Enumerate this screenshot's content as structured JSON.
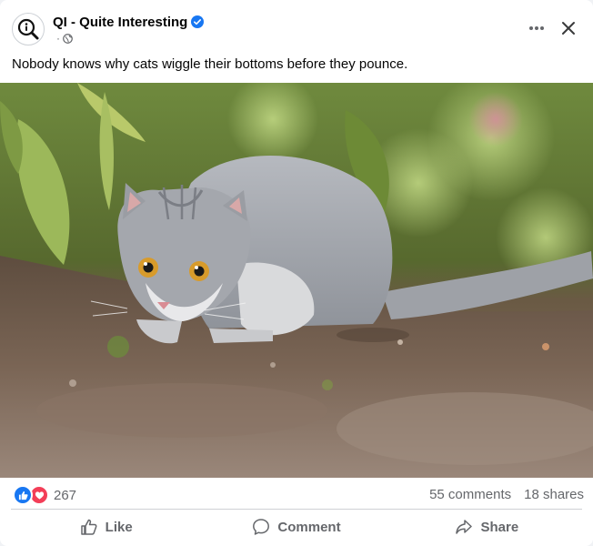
{
  "post": {
    "page_name": "QI - Quite Interesting",
    "meta_dot": "·",
    "caption": "Nobody knows why cats wiggle their bottoms before they pounce."
  },
  "image": {
    "alt": "Grey cat crouching low on soil, ready to pounce, with green leaves in the background"
  },
  "engagement": {
    "reaction_count": "267",
    "comments": "55 comments",
    "shares": "18 shares"
  },
  "actions": {
    "like_label": "Like",
    "comment_label": "Comment",
    "share_label": "Share"
  },
  "icons": {
    "avatar": "qi-logo-icon",
    "verified": "verified-badge-icon",
    "privacy": "globe-icon",
    "more": "more-options-icon",
    "close": "close-icon",
    "reaction_like": "like-reaction-icon",
    "reaction_love": "love-reaction-icon",
    "like": "thumbs-up-icon",
    "comment": "comment-bubble-icon",
    "share": "share-arrow-icon"
  },
  "colors": {
    "brand_blue": "#1877f2",
    "love_red": "#f33e58",
    "secondary_text": "#65676b"
  }
}
